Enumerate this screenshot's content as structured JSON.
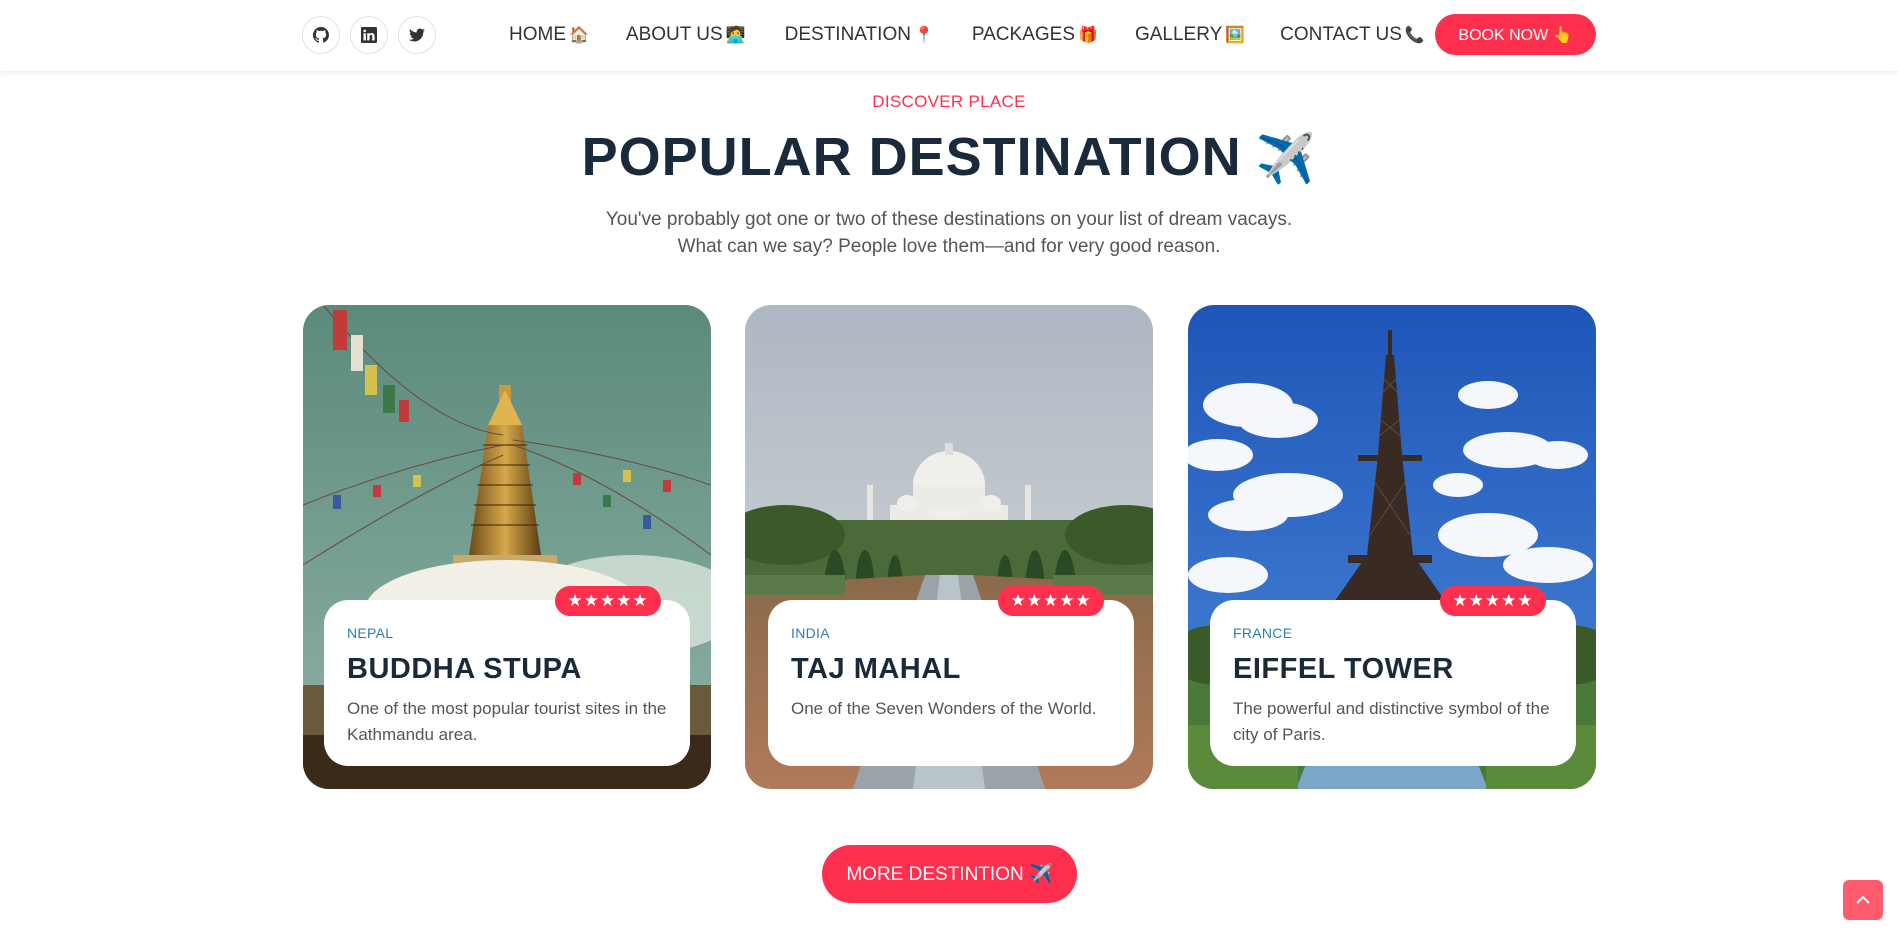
{
  "header": {
    "socials": [
      {
        "icon": "github-icon"
      },
      {
        "icon": "linkedin-icon"
      },
      {
        "icon": "twitter-icon"
      }
    ],
    "nav": [
      {
        "label": "HOME",
        "emoji": "🏠"
      },
      {
        "label": "ABOUT US",
        "emoji": "🧑‍💻"
      },
      {
        "label": "DESTINATION",
        "emoji": "📍"
      },
      {
        "label": "PACKAGES",
        "emoji": "🎁"
      },
      {
        "label": "GALLERY",
        "emoji": "🖼️"
      },
      {
        "label": "CONTACT US",
        "emoji": "📞"
      }
    ],
    "book_label": "BOOK NOW 👆"
  },
  "section": {
    "eyebrow": "DISCOVER PLACE",
    "title": "POPULAR DESTINATION",
    "title_emoji": "✈️",
    "subtitle": "You've probably got one or two of these destinations on your list of dream vacays. What can we say? People love them—and for very good reason."
  },
  "cards": [
    {
      "country": "NEPAL",
      "name": "BUDDHA STUPA",
      "desc": "One of the most popular tourist sites in the Kathmandu area.",
      "rating": "★★★★★"
    },
    {
      "country": "INDIA",
      "name": "TAJ MAHAL",
      "desc": "One of the Seven Wonders of the World.",
      "rating": "★★★★★"
    },
    {
      "country": "FRANCE",
      "name": "EIFFEL TOWER",
      "desc": "The powerful and distinctive symbol of the city of Paris.",
      "rating": "★★★★★"
    }
  ],
  "more_label": "MORE DESTINTION ✈️",
  "colors": {
    "accent": "#ff2f4e",
    "heading": "#1b2a3a",
    "country": "#2a7fb8"
  }
}
